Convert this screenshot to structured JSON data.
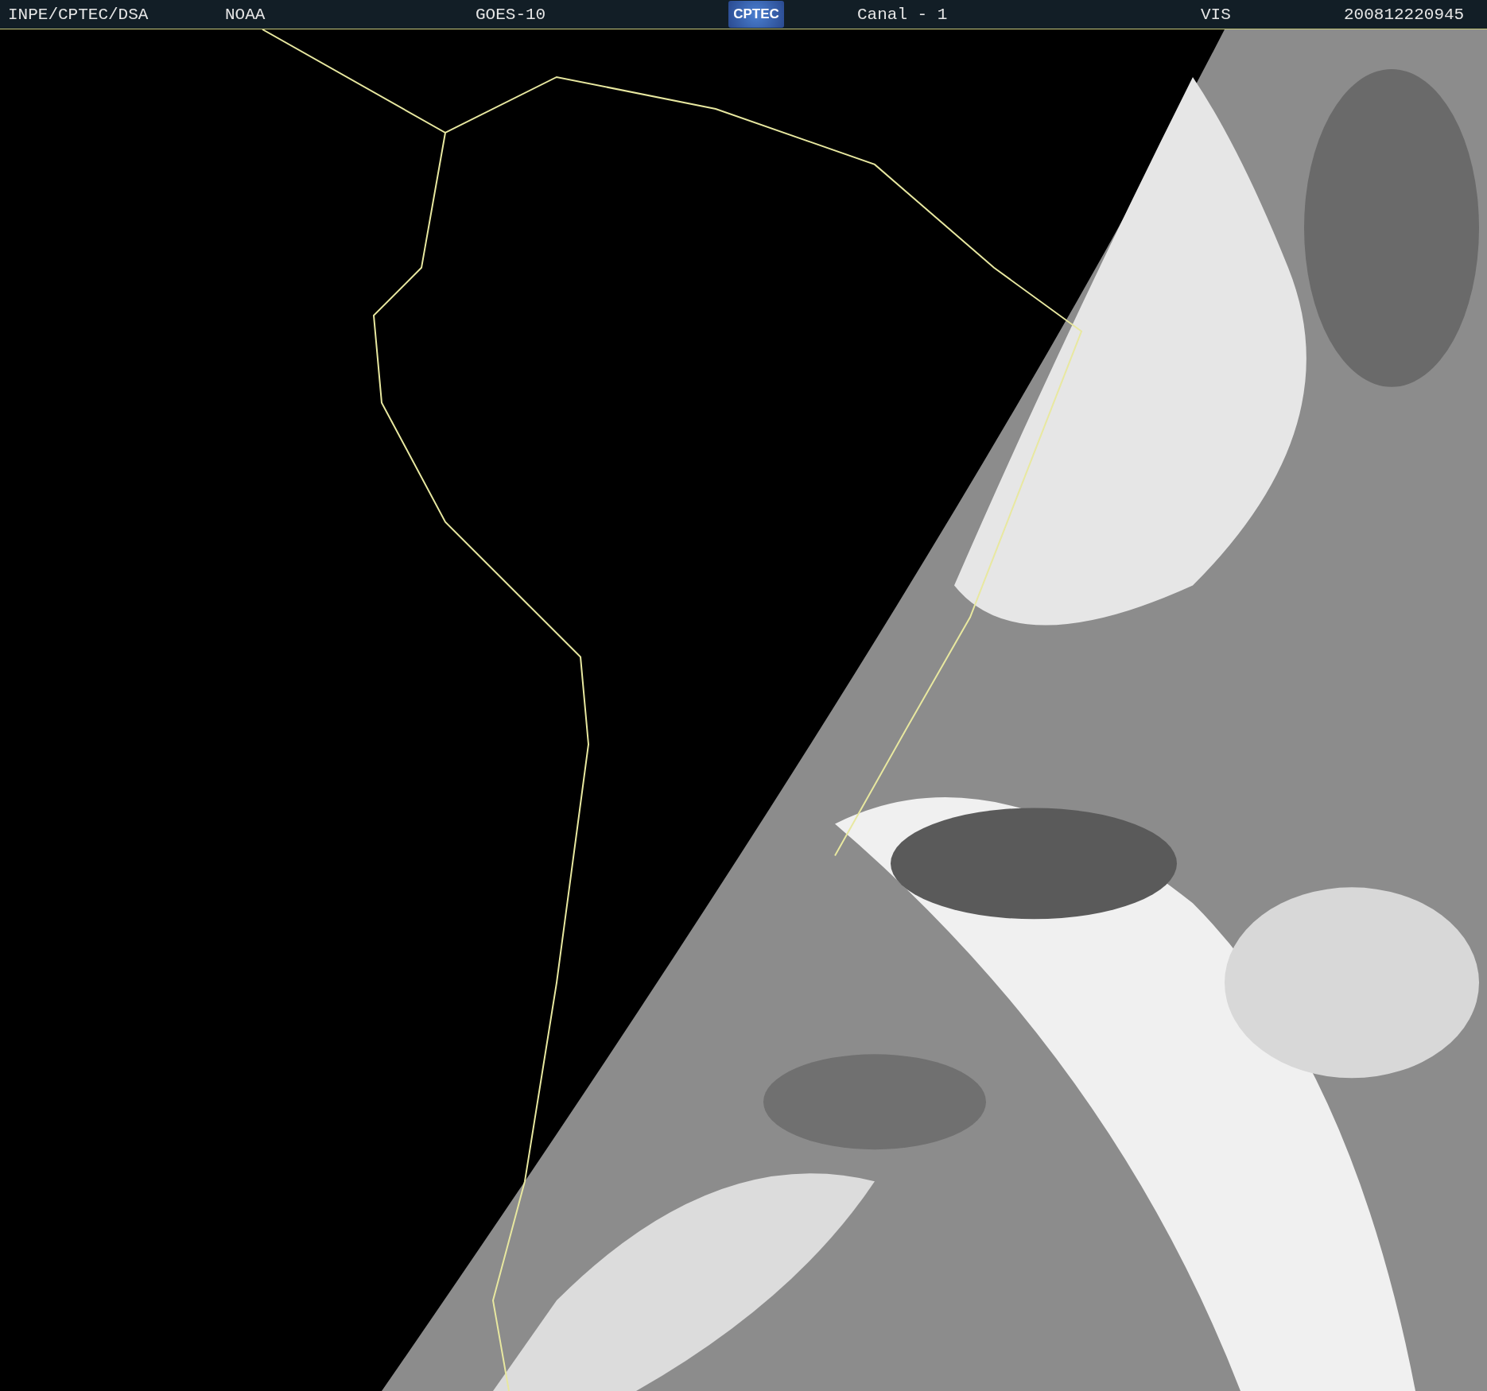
{
  "header": {
    "agency": "INPE/CPTEC/DSA",
    "source": "NOAA",
    "satellite": "GOES-10",
    "logo": "CPTEC",
    "channel": "Canal - 1",
    "band": "VIS",
    "timestamp": "200812220945"
  }
}
